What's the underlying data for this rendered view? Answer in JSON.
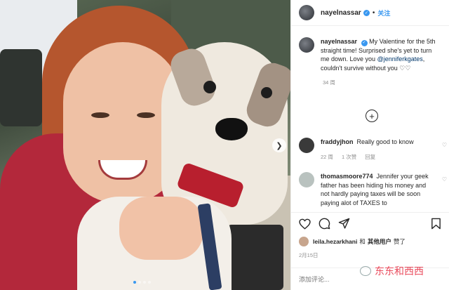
{
  "post": {
    "username": "nayelnassar",
    "follow_label": "关注",
    "separator": "•",
    "caption_prefix": "My Valentine for the 5th straight time! Surprised she's yet to turn me down. Love you ",
    "caption_mention": "@jenniferkgates",
    "caption_suffix": ", couldn't survive without you ♡♡",
    "caption_time": "34 周"
  },
  "comments": [
    {
      "username": "fraddyjhon",
      "text": "Really good to know",
      "time": "22 周",
      "likes": "1 次赞",
      "reply": "回复",
      "avatar_color": "#3a3a3a"
    },
    {
      "username": "thomasmoore774",
      "text": "Jennifer your geek father has been hiding his money and not hardly paying taxes will be soon paying alot of TAXES to",
      "avatar_color": "#b9c2bf"
    }
  ],
  "likes": {
    "user": "leila.hezarkhani",
    "connector": "和",
    "others": "其他用户",
    "suffix": "赞了"
  },
  "date": "2月15日",
  "add_comment": {
    "placeholder": "添加评论..."
  },
  "watermark": "东东和西西",
  "icons": {
    "heart": "heart-icon",
    "comment": "comment-icon",
    "share": "share-icon",
    "bookmark": "bookmark-icon",
    "plus": "plus-circle-icon",
    "next": "chevron-right-icon"
  },
  "colors": {
    "accent": "#3897f0",
    "mention": "#00376b",
    "muted": "#8e8e8e",
    "watermark": "#ea4c5d"
  }
}
